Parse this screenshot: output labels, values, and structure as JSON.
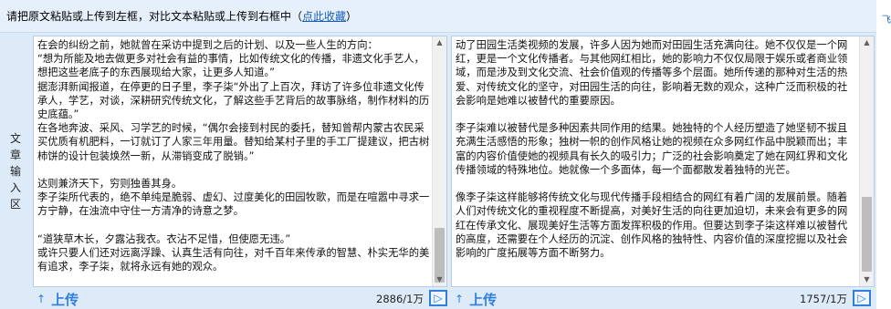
{
  "topbar": {
    "instruction": "请把原文粘贴或上传到左框，对比文本粘贴或上传到右框中（",
    "link": "点此收藏",
    "close_paren": "）"
  },
  "edge_text": "飞",
  "side_label": "文章输入区",
  "left_editor": {
    "text": "在会的纠纷之前，她就曾在采访中提到之后的计划、以及一些人生的方向：\n“想为所能及地去做更多对社会有益的事情，比如传统文化的传播，非遗文化手艺人，想把这些老底子的东西展现给大家，让更多人知道。”\n据澎湃新闻报道，在停更的日子里，李子柒“外出了上百次，拜访了许多位非遗文化传承人，学艺，对谈，深耕研究传统文化，了解这些手艺背后的故事脉络，制作材料的历史底蕴。”\n在各地奔波、采风、习学艺的时候，“偶尔会接到村民的委托，替知曾帮内蒙古农民采买优质有机肥料，一订就订了人家三年用量。替知给某村子里的手工厂提建议，把古树柿饼的设计包装焕然一新，从滞销变成了脱销。”\n\n达则兼济天下，穷则独善其身。\n李子柒所代表的，绝不单纯是脆弱、虚幻、过度美化的田园牧歌，而是在喧嚣中寻求一方宁静，在浊流中守住一方清净的诗意之梦。\n\n“道狭草木长，夕露沾我衣。衣沾不足惜，但使愿无违。”\n或许只要人们还对远离浮躁、认真生活有向往，对千百年来传承的智慧、朴实无华的美有追求，李子柒，就将永远有她的观众。",
    "count": "2886/1万"
  },
  "right_editor": {
    "text": "动了田园生活类视频的发展，许多人因为她而对田园生活充满向往。她不仅仅是一个网红，更是一个文化传播者。与其他网红相比，她的影响力不仅仅局限于娱乐或者商业领域，而是涉及到文化交流、社会价值观的传播等多个层面。她所传递的那种对生活的热爱、对传统文化的坚守，对田园生活的向往，影响着无数的观众，这种广泛而积极的社会影响是她难以被替代的重要原因。\n\n李子柒难以被替代是多种因素共同作用的结果。她独特的个人经历塑造了她坚韧不拔且充满生活感悟的形象；独树一帜的创作风格让她的视频在众多网红作品中脱颖而出；丰富的内容价值使她的视频具有长久的吸引力；广泛的社会影响奠定了她在网红界和文化传播领域的特殊地位。她就像一个多面体，每一个面都散发着独特的光芒。\n\n像李子柒这样能够将传统文化与现代传播手段相结合的网红有着广阔的发展前景。随着人们对传统文化的重视程度不断提高，对美好生活的向往更加迫切，未来会有更多的网红在传承文化、展现美好生活等方面发挥积极的作用。但要达到李子柒这样难以被替代的高度，还需要在个人经历的沉淀、创作风格的独特性、内容价值的深度挖掘以及社会影响的广度拓展等方面不断努力。",
    "count": "1757/1万"
  },
  "upload_label": "上传",
  "icons": {
    "upload": "upload-arrow-icon",
    "send": "send-compare-icon"
  }
}
